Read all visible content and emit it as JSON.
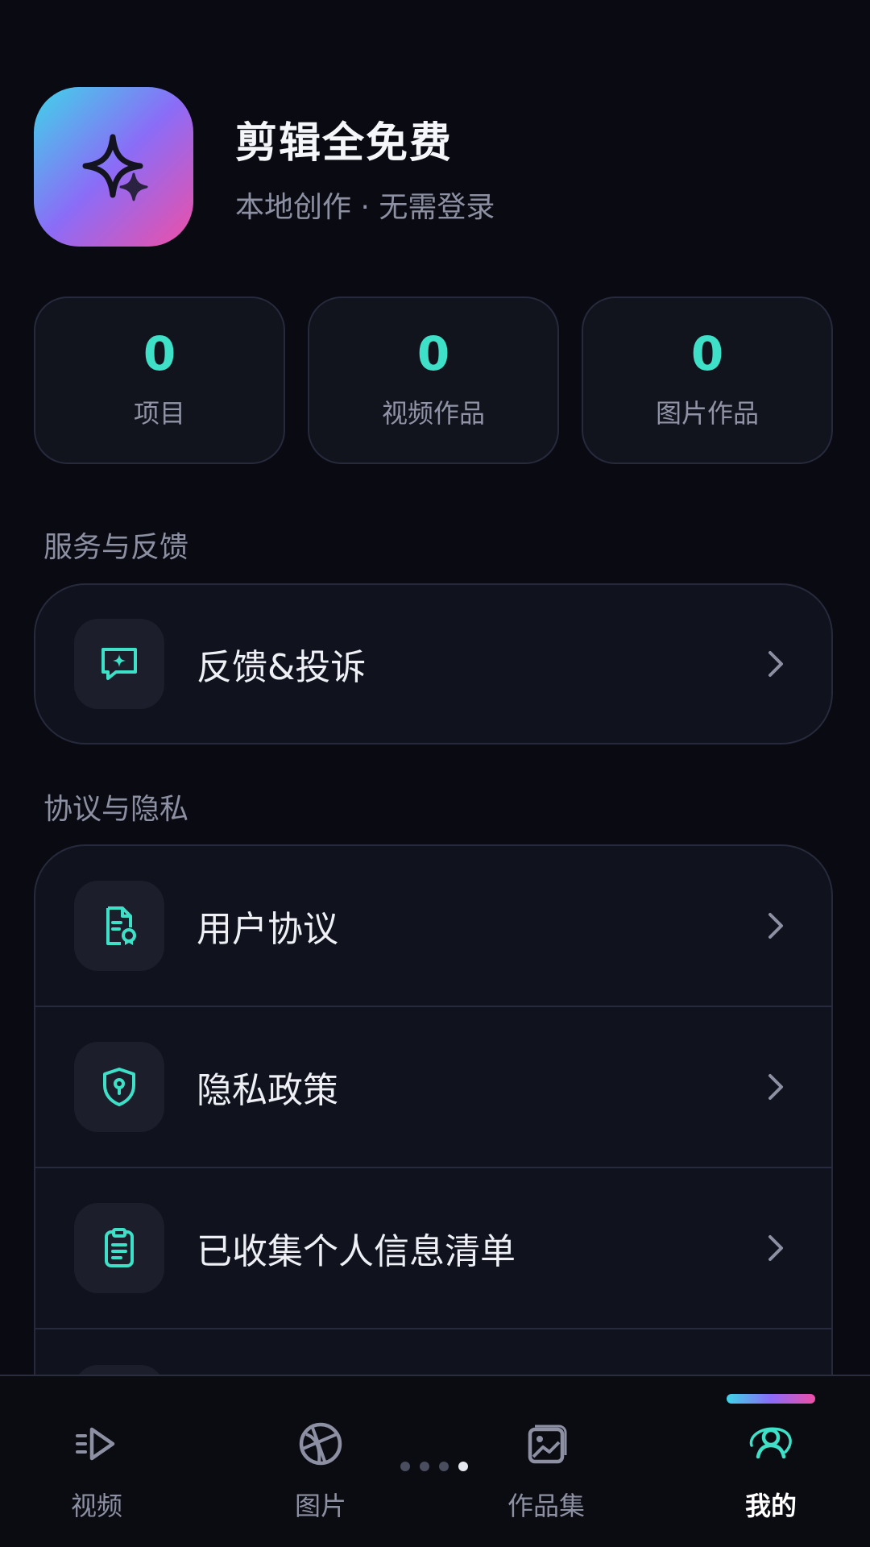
{
  "profile": {
    "name": "剪辑全免费",
    "subtitle": "本地创作 · 无需登录"
  },
  "stats": [
    {
      "value": "0",
      "label": "项目"
    },
    {
      "value": "0",
      "label": "视频作品"
    },
    {
      "value": "0",
      "label": "图片作品"
    }
  ],
  "sections": {
    "service": {
      "title": "服务与反馈",
      "items": [
        {
          "label": "反馈&投诉",
          "icon": "feedback-icon"
        }
      ]
    },
    "privacy": {
      "title": "协议与隐私",
      "items": [
        {
          "label": "用户协议",
          "icon": "document-badge-icon"
        },
        {
          "label": "隐私政策",
          "icon": "shield-lock-icon"
        },
        {
          "label": "已收集个人信息清单",
          "icon": "clipboard-list-icon"
        }
      ]
    }
  },
  "nav": {
    "items": [
      {
        "label": "视频",
        "icon": "video-play-icon"
      },
      {
        "label": "图片",
        "icon": "image-aperture-icon"
      },
      {
        "label": "作品集",
        "icon": "gallery-icon"
      },
      {
        "label": "我的",
        "icon": "user-icon",
        "active": true
      }
    ],
    "page_dots": 4,
    "active_dot": 4
  },
  "colors": {
    "accent": "#3ee0c8",
    "background": "#0a0b12",
    "card": "#10121d",
    "gradient_start": "#3fd4e8",
    "gradient_mid": "#8b6cf7",
    "gradient_end": "#ee4fa6"
  }
}
